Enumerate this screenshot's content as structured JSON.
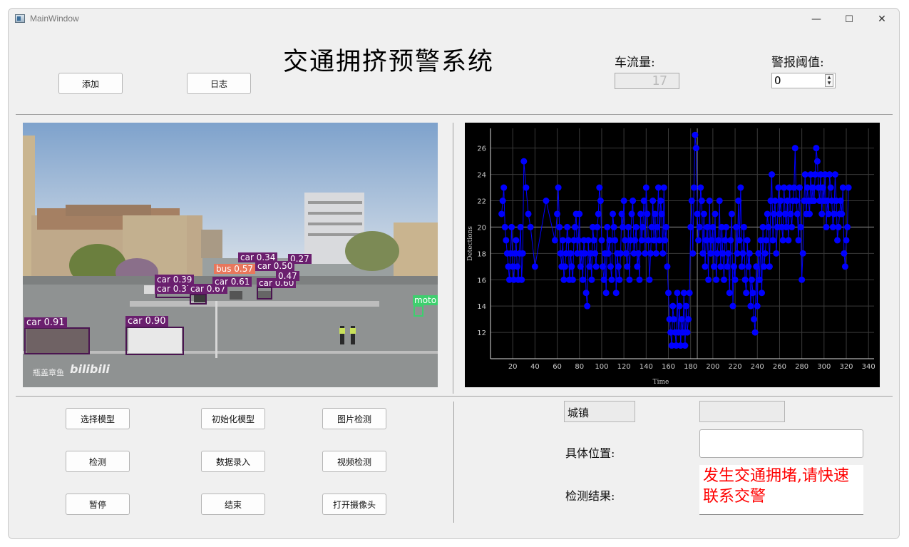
{
  "window": {
    "title": "MainWindow",
    "min_icon": "minimize-icon",
    "max_icon": "maximize-icon",
    "close_icon": "close-icon",
    "min_glyph": "—",
    "max_glyph": "☐",
    "close_glyph": "✕"
  },
  "header": {
    "add_label": "添加",
    "log_label": "日志",
    "app_title": "交通拥挤预警系统",
    "flow_label": "车流量:",
    "flow_display": "17",
    "threshold_label": "警报阈值:",
    "threshold_value": "0"
  },
  "video": {
    "watermark_name": "瓶盖章鱼",
    "watermark_logo": "bilibili",
    "detections": [
      {
        "label": "car 0.91",
        "color": "#6a1f6e"
      },
      {
        "label": "car 0.90",
        "color": "#6a1f6e"
      },
      {
        "label": "car 0.39",
        "color": "#6a1f6e"
      },
      {
        "label": "car 0.37",
        "color": "#6a1f6e"
      },
      {
        "label": "car 0.67",
        "color": "#6a1f6e"
      },
      {
        "label": "car 0.61",
        "color": "#6a1f6e"
      },
      {
        "label": "car 0.60",
        "color": "#6a1f6e"
      },
      {
        "label": "car 0.34",
        "color": "#6a1f6e"
      },
      {
        "label": "0.27",
        "color": "#6a1f6e"
      },
      {
        "label": "car 0.50",
        "color": "#6a1f6e"
      },
      {
        "label": "0.47",
        "color": "#6a1f6e"
      },
      {
        "label": "bus 0.57",
        "color": "#e8775c"
      },
      {
        "label": "moto",
        "color": "#3ecf6e"
      }
    ]
  },
  "chart_data": {
    "type": "scatter",
    "xlabel": "Time",
    "ylabel": "Detections",
    "xlim": [
      0,
      345
    ],
    "ylim": [
      10,
      27.5
    ],
    "x_ticks": [
      20,
      40,
      60,
      80,
      100,
      120,
      140,
      160,
      180,
      200,
      220,
      240,
      260,
      280,
      300,
      320,
      340
    ],
    "y_ticks": [
      12,
      14,
      16,
      18,
      20,
      22,
      24,
      26
    ],
    "grid": true,
    "background": "#000000",
    "marker_color": "#0000ff",
    "series": [
      {
        "values": [
          [
            10,
            21
          ],
          [
            11,
            22
          ],
          [
            12,
            23
          ],
          [
            13,
            20
          ],
          [
            14,
            19
          ],
          [
            15,
            18
          ],
          [
            16,
            17
          ],
          [
            17,
            16
          ],
          [
            18,
            18
          ],
          [
            19,
            20
          ],
          [
            20,
            17
          ],
          [
            21,
            16
          ],
          [
            22,
            18
          ],
          [
            23,
            19
          ],
          [
            24,
            17
          ],
          [
            25,
            16
          ],
          [
            26,
            18
          ],
          [
            27,
            20
          ],
          [
            28,
            16
          ],
          [
            29,
            18
          ],
          [
            30,
            25
          ],
          [
            32,
            23
          ],
          [
            34,
            21
          ],
          [
            36,
            20
          ],
          [
            40,
            17
          ],
          [
            50,
            22
          ],
          [
            58,
            19
          ],
          [
            60,
            21
          ],
          [
            61,
            23
          ],
          [
            62,
            20
          ],
          [
            63,
            18
          ],
          [
            64,
            17
          ],
          [
            65,
            19
          ],
          [
            66,
            16
          ],
          [
            67,
            17
          ],
          [
            68,
            18
          ],
          [
            69,
            20
          ],
          [
            70,
            19
          ],
          [
            71,
            16
          ],
          [
            72,
            18
          ],
          [
            73,
            17
          ],
          [
            74,
            16
          ],
          [
            75,
            19
          ],
          [
            76,
            20
          ],
          [
            77,
            21
          ],
          [
            78,
            18
          ],
          [
            79,
            19
          ],
          [
            80,
            21
          ],
          [
            81,
            17
          ],
          [
            82,
            18
          ],
          [
            83,
            16
          ],
          [
            84,
            19
          ],
          [
            85,
            18
          ],
          [
            86,
            15
          ],
          [
            87,
            14
          ],
          [
            88,
            19
          ],
          [
            89,
            17
          ],
          [
            90,
            18
          ],
          [
            91,
            16
          ],
          [
            92,
            20
          ],
          [
            93,
            19
          ],
          [
            94,
            18
          ],
          [
            95,
            17
          ],
          [
            96,
            20
          ],
          [
            97,
            21
          ],
          [
            98,
            23
          ],
          [
            99,
            22
          ],
          [
            100,
            19
          ],
          [
            101,
            17
          ],
          [
            102,
            16
          ],
          [
            103,
            18
          ],
          [
            104,
            15
          ],
          [
            105,
            20
          ],
          [
            106,
            18
          ],
          [
            107,
            19
          ],
          [
            108,
            17
          ],
          [
            109,
            16
          ],
          [
            110,
            21
          ],
          [
            111,
            20
          ],
          [
            112,
            19
          ],
          [
            113,
            15
          ],
          [
            114,
            18
          ],
          [
            115,
            17
          ],
          [
            116,
            16
          ],
          [
            117,
            18
          ],
          [
            118,
            21
          ],
          [
            119,
            20
          ],
          [
            120,
            22
          ],
          [
            121,
            19
          ],
          [
            122,
            18
          ],
          [
            123,
            17
          ],
          [
            124,
            20
          ],
          [
            125,
            16
          ],
          [
            126,
            19
          ],
          [
            127,
            21
          ],
          [
            128,
            22
          ],
          [
            129,
            18
          ],
          [
            130,
            19
          ],
          [
            131,
            20
          ],
          [
            132,
            17
          ],
          [
            133,
            18
          ],
          [
            134,
            16
          ],
          [
            135,
            21
          ],
          [
            136,
            19
          ],
          [
            137,
            20
          ],
          [
            138,
            22
          ],
          [
            139,
            18
          ],
          [
            140,
            23
          ],
          [
            141,
            21
          ],
          [
            142,
            19
          ],
          [
            143,
            16
          ],
          [
            144,
            18
          ],
          [
            145,
            20
          ],
          [
            146,
            22
          ],
          [
            147,
            19
          ],
          [
            148,
            21
          ],
          [
            149,
            18
          ],
          [
            150,
            20
          ],
          [
            151,
            23
          ],
          [
            152,
            19
          ],
          [
            153,
            22
          ],
          [
            154,
            21
          ],
          [
            155,
            18
          ],
          [
            156,
            23
          ],
          [
            157,
            19
          ],
          [
            158,
            20
          ],
          [
            159,
            17
          ],
          [
            160,
            15
          ],
          [
            161,
            13
          ],
          [
            162,
            12
          ],
          [
            163,
            11
          ],
          [
            164,
            14
          ],
          [
            165,
            13
          ],
          [
            166,
            12
          ],
          [
            167,
            11
          ],
          [
            168,
            15
          ],
          [
            169,
            12
          ],
          [
            170,
            14
          ],
          [
            171,
            11
          ],
          [
            172,
            13
          ],
          [
            173,
            12
          ],
          [
            174,
            15
          ],
          [
            175,
            11
          ],
          [
            176,
            14
          ],
          [
            177,
            12
          ],
          [
            178,
            13
          ],
          [
            179,
            15
          ],
          [
            180,
            20
          ],
          [
            181,
            22
          ],
          [
            182,
            18
          ],
          [
            183,
            23
          ],
          [
            184,
            27
          ],
          [
            185,
            26
          ],
          [
            186,
            21
          ],
          [
            187,
            19
          ],
          [
            188,
            20
          ],
          [
            189,
            23
          ],
          [
            190,
            22
          ],
          [
            191,
            18
          ],
          [
            192,
            21
          ],
          [
            193,
            17
          ],
          [
            194,
            19
          ],
          [
            195,
            20
          ],
          [
            196,
            16
          ],
          [
            197,
            22
          ],
          [
            198,
            18
          ],
          [
            199,
            19
          ],
          [
            200,
            20
          ],
          [
            201,
            17
          ],
          [
            202,
            21
          ],
          [
            203,
            16
          ],
          [
            204,
            18
          ],
          [
            205,
            19
          ],
          [
            206,
            22
          ],
          [
            207,
            17
          ],
          [
            208,
            20
          ],
          [
            209,
            18
          ],
          [
            210,
            16
          ],
          [
            211,
            19
          ],
          [
            212,
            20
          ],
          [
            213,
            17
          ],
          [
            214,
            18
          ],
          [
            215,
            15
          ],
          [
            216,
            19
          ],
          [
            217,
            21
          ],
          [
            218,
            14
          ],
          [
            219,
            17
          ],
          [
            220,
            16
          ],
          [
            221,
            20
          ],
          [
            222,
            18
          ],
          [
            223,
            22
          ],
          [
            224,
            19
          ],
          [
            225,
            23
          ],
          [
            226,
            17
          ],
          [
            227,
            18
          ],
          [
            228,
            20
          ],
          [
            229,
            16
          ],
          [
            230,
            15
          ],
          [
            231,
            19
          ],
          [
            232,
            17
          ],
          [
            233,
            18
          ],
          [
            234,
            14
          ],
          [
            235,
            16
          ],
          [
            236,
            15
          ],
          [
            237,
            13
          ],
          [
            238,
            12
          ],
          [
            239,
            17
          ],
          [
            240,
            14
          ],
          [
            241,
            18
          ],
          [
            242,
            16
          ],
          [
            243,
            19
          ],
          [
            244,
            15
          ],
          [
            245,
            20
          ],
          [
            246,
            17
          ],
          [
            247,
            18
          ],
          [
            248,
            19
          ],
          [
            249,
            21
          ],
          [
            250,
            20
          ],
          [
            251,
            17
          ],
          [
            252,
            22
          ],
          [
            253,
            24
          ],
          [
            254,
            19
          ],
          [
            255,
            21
          ],
          [
            256,
            22
          ],
          [
            257,
            18
          ],
          [
            258,
            20
          ],
          [
            259,
            23
          ],
          [
            260,
            21
          ],
          [
            261,
            22
          ],
          [
            262,
            20
          ],
          [
            263,
            19
          ],
          [
            264,
            23
          ],
          [
            265,
            21
          ],
          [
            266,
            20
          ],
          [
            267,
            22
          ],
          [
            268,
            19
          ],
          [
            269,
            23
          ],
          [
            270,
            21
          ],
          [
            271,
            20
          ],
          [
            272,
            22
          ],
          [
            273,
            23
          ],
          [
            274,
            26
          ],
          [
            275,
            22
          ],
          [
            276,
            21
          ],
          [
            277,
            19
          ],
          [
            278,
            23
          ],
          [
            279,
            20
          ],
          [
            280,
            16
          ],
          [
            281,
            18
          ],
          [
            282,
            22
          ],
          [
            283,
            24
          ],
          [
            284,
            21
          ],
          [
            285,
            23
          ],
          [
            286,
            22
          ],
          [
            287,
            21
          ],
          [
            288,
            24
          ],
          [
            289,
            22
          ],
          [
            290,
            23
          ],
          [
            291,
            22
          ],
          [
            292,
            24
          ],
          [
            293,
            26
          ],
          [
            294,
            25
          ],
          [
            295,
            23
          ],
          [
            296,
            22
          ],
          [
            297,
            24
          ],
          [
            298,
            21
          ],
          [
            299,
            23
          ],
          [
            300,
            22
          ],
          [
            301,
            24
          ],
          [
            302,
            20
          ],
          [
            303,
            22
          ],
          [
            304,
            21
          ],
          [
            305,
            24
          ],
          [
            306,
            23
          ],
          [
            307,
            22
          ],
          [
            308,
            20
          ],
          [
            309,
            21
          ],
          [
            310,
            24
          ],
          [
            311,
            22
          ],
          [
            312,
            19
          ],
          [
            313,
            20
          ],
          [
            314,
            21
          ],
          [
            315,
            22
          ],
          [
            316,
            21
          ],
          [
            317,
            23
          ],
          [
            318,
            18
          ],
          [
            319,
            17
          ],
          [
            320,
            19
          ],
          [
            321,
            20
          ],
          [
            322,
            23
          ]
        ]
      }
    ]
  },
  "controls": {
    "select_model": "选择模型",
    "init_model": "初始化模型",
    "image_detect": "图片检测",
    "detect": "检测",
    "data_entry": "数据录入",
    "video_detect": "视频检测",
    "pause": "暂停",
    "end": "结束",
    "open_camera": "打开摄像头"
  },
  "info": {
    "town_label": "城镇",
    "town_value": "",
    "location_label": "具体位置:",
    "location_value": "",
    "result_label": "检测结果:",
    "result_text": "发生交通拥堵,请快速联系交警",
    "result_color": "#ff0000"
  }
}
